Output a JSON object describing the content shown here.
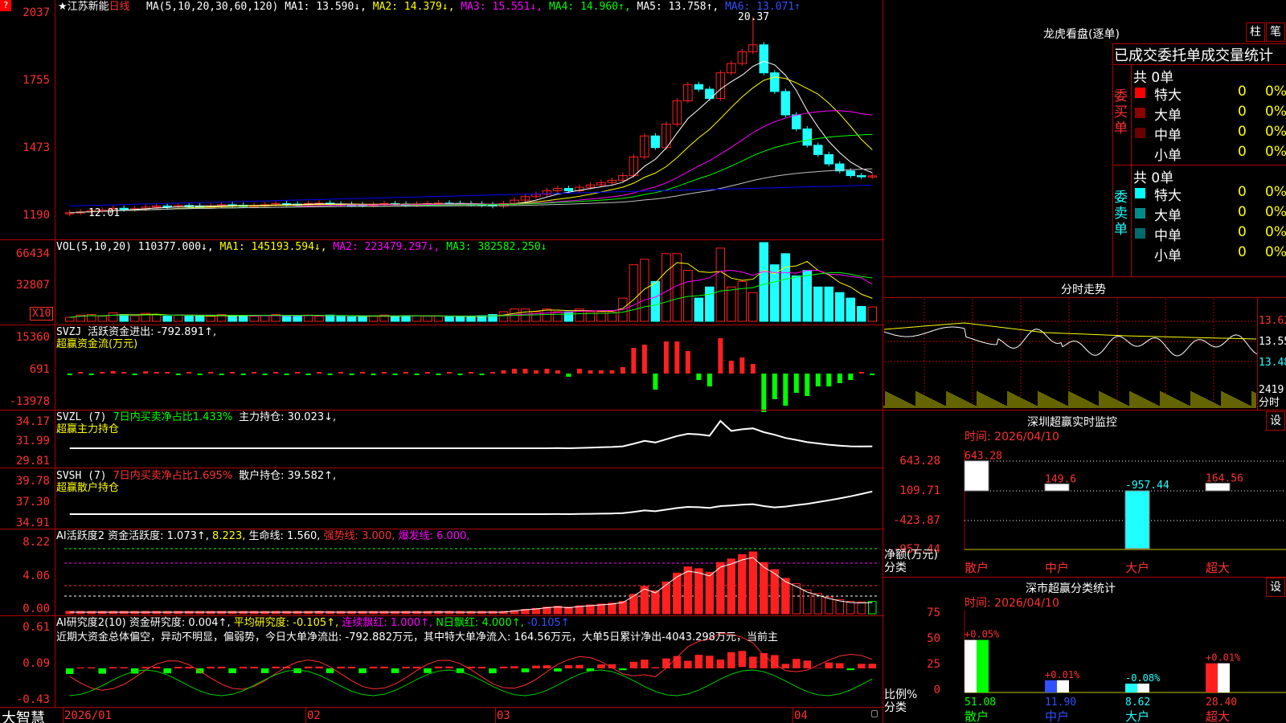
{
  "colors": {
    "up": "#ff2020",
    "down": "#20ffff",
    "ma1": "#ffffff",
    "ma2": "#ffff00",
    "ma3": "#ff00ff",
    "ma4": "#00ff00",
    "ma5": "#c0c0c0",
    "ma6": "#0000ff",
    "grid": "#b00000",
    "axis": "#ff3030"
  },
  "header": {
    "flag": "?",
    "star": "★",
    "stock": "江苏新能",
    "period": "日线",
    "ma_params": "MA(5,10,20,30,60,120)",
    "ma1": "MA1: 13.590↓,",
    "ma2": "MA2: 14.379↓,",
    "ma3": "MA3: 15.551↓,",
    "ma4": "MA4: 14.960↑,",
    "ma5": "MA5: 13.758↑,",
    "ma6": "MA6: 13.071↑"
  },
  "price_axis": [
    "2037",
    "1755",
    "1473",
    "1190"
  ],
  "price_marks": {
    "high": "20.37",
    "low": "12.01"
  },
  "vol": {
    "title": "VOL(5,10,20)",
    "value": "110377.000↓,",
    "ma1": "MA1: 145193.594↓,",
    "ma2": "MA2: 223479.297↓,",
    "ma3": "MA3: 382582.250↓",
    "axis": [
      "66434",
      "32807"
    ],
    "unit": "X10"
  },
  "svzj": {
    "title": "SVZJ",
    "text": "活跃资金进出: -792.891↑,",
    "sub": "超赢资金流(万元)",
    "axis": [
      "15360",
      "691",
      "-13978"
    ]
  },
  "svzl": {
    "title": "SVZL (7)",
    "text1": "7日内买卖净占比1.433%",
    "text2": "主力持仓: 30.023↓,",
    "sub": "超赢主力持仓",
    "axis": [
      "34.17",
      "31.99",
      "29.81"
    ]
  },
  "svsh": {
    "title": "SVSH (7)",
    "text1": "7日内买卖净占比1.695%",
    "text2": "散户持仓: 39.582↑,",
    "sub": "超赢散户持仓",
    "axis": [
      "39.78",
      "37.30",
      "34.91"
    ]
  },
  "ai1": {
    "title": "AI活跃度2",
    "t1": "资金活跃度: 1.073↑,",
    "t2": "8.223,",
    "t3": "生命线: 1.560,",
    "t4": "强势线: 3.000,",
    "t5": "爆发线: 6.000,",
    "axis": [
      "8.22",
      "4.06",
      "0.00"
    ]
  },
  "ai2": {
    "title": "AI研究度2(10)",
    "t1": "资金研究度: 0.004↑,",
    "t2": "平均研究度: -0.105↑,",
    "t3": "连续飘红: 1.000↑,",
    "t4": "N日飘红: 4.000↑,",
    "t5": "-0.105↑",
    "desc": "近期大资金总体偏空，异动不明显，偏弱势，今日大单净流出: -792.882万元，其中特大单净流入: 164.56万元，大单5日累计净出-4043.298万元，当前主",
    "axis": [
      "0.61",
      "0.09",
      "-0.43"
    ]
  },
  "footer": {
    "brand": "大智慧",
    "dates": [
      "2026/01",
      "02",
      "03",
      "04"
    ]
  },
  "lhb": {
    "title": "龙虎看盘(逐单)",
    "btn1": "柱",
    "btn2": "笔",
    "header": "已成交委托单成交量统计",
    "buy": {
      "label": "委买单",
      "total": "共 0单",
      "rows": [
        {
          "n": "特大",
          "v": "0",
          "p": "0%",
          "c": "#ff0000"
        },
        {
          "n": "大单",
          "v": "0",
          "p": "0%",
          "c": "#8b0000"
        },
        {
          "n": "中单",
          "v": "0",
          "p": "0%",
          "c": "#6b0000"
        },
        {
          "n": "小单",
          "v": "0",
          "p": "0%",
          "c": "#000000"
        }
      ]
    },
    "sell": {
      "label": "委卖单",
      "total": "共 0单",
      "rows": [
        {
          "n": "特大",
          "v": "0",
          "p": "0%",
          "c": "#00ffff"
        },
        {
          "n": "大单",
          "v": "0",
          "p": "0%",
          "c": "#008b8b"
        },
        {
          "n": "中单",
          "v": "0",
          "p": "0%",
          "c": "#006b6b"
        },
        {
          "n": "小单",
          "v": "0",
          "p": "0%",
          "c": "#000000"
        }
      ]
    }
  },
  "fenshi": {
    "title": "分时走势",
    "axis": [
      "13.62",
      "13.55",
      "13.48"
    ],
    "vol_label": "2419",
    "vol_unit": "分时"
  },
  "monitor": {
    "title": "深圳超赢实时监控",
    "btn": "设",
    "time": "时间: 2026/04/10",
    "axis": [
      "643.28",
      "109.71",
      "-423.87",
      "-957.44"
    ],
    "ylabel": "净额(万元)",
    "xlabel": "分类",
    "values": [
      {
        "cat": "散户",
        "v": 643.28,
        "label": "643.28"
      },
      {
        "cat": "中户",
        "v": 149.6,
        "label": "149.6"
      },
      {
        "cat": "大户",
        "v": -957.44,
        "label": "-957.44"
      },
      {
        "cat": "超大",
        "v": 164.56,
        "label": "164.56"
      }
    ]
  },
  "classify": {
    "title": "深市超赢分类统计",
    "btn": "设",
    "time": "时间: 2026/04/10",
    "axis": [
      "75",
      "50",
      "25",
      "0"
    ],
    "ylabel": "比例%",
    "xlabel": "分类",
    "values": [
      {
        "cat": "散户",
        "v": 51.08,
        "label": "51.08",
        "chg": "+0.05%"
      },
      {
        "cat": "中户",
        "v": 11.9,
        "label": "11.90",
        "chg": "+0.01%"
      },
      {
        "cat": "大户",
        "v": 8.62,
        "label": "8.62",
        "chg": "-0.08%"
      },
      {
        "cat": "超大",
        "v": 28.4,
        "label": "28.40",
        "chg": "+0.01%"
      }
    ]
  },
  "chart_data": {
    "type": "candlestick",
    "closes": [
      12.01,
      12.05,
      12.1,
      12.12,
      12.2,
      12.15,
      12.18,
      12.25,
      12.3,
      12.28,
      12.32,
      12.3,
      12.28,
      12.3,
      12.35,
      12.33,
      12.3,
      12.32,
      12.35,
      12.4,
      12.38,
      12.36,
      12.4,
      12.42,
      12.38,
      12.36,
      12.35,
      12.34,
      12.36,
      12.4,
      12.38,
      12.35,
      12.38,
      12.4,
      12.42,
      12.41,
      12.4,
      12.38,
      12.35,
      12.3,
      12.4,
      12.55,
      12.7,
      12.8,
      12.95,
      13.05,
      12.95,
      13.1,
      13.2,
      13.3,
      13.4,
      13.6,
      14.4,
      15.3,
      14.8,
      15.8,
      16.8,
      17.5,
      17.3,
      16.9,
      18.0,
      18.4,
      18.9,
      19.2,
      18.0,
      17.2,
      16.2,
      15.6,
      14.9,
      14.5,
      14.1,
      13.8,
      13.6,
      13.55,
      13.59
    ]
  }
}
